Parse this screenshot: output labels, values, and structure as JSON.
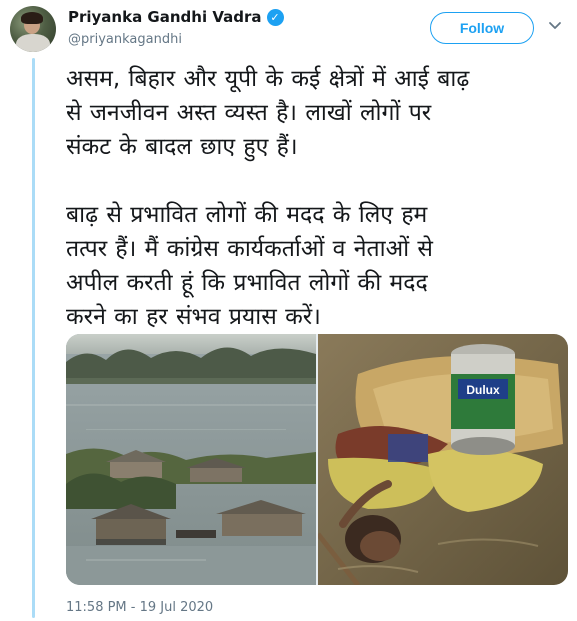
{
  "author": {
    "name": "Priyanka Gandhi Vadra",
    "handle": "@priyankagandhi",
    "verified_icon": "verified-badge-icon"
  },
  "follow_button": {
    "label": "Follow"
  },
  "menu_icon": "chevron-down-icon",
  "tweet": {
    "text": "असम, बिहार और यूपी के कई क्षेत्रों में आई बाढ़\nसे जनजीवन अस्त व्यस्त है। लाखों लोगों पर\nसंकट के बादल छाए हुए हैं।\n\nबाढ़ से प्रभावित लोगों की मदद के लिए हम\nतत्पर हैं। मैं कांग्रेस कार्यकर्ताओं व नेताओं से\nअपील करती हूं कि प्रभावित लोगों की मदद\nकरने का हर संभव प्रयास करें।",
    "timestamp": "11:58 PM - 19 Jul 2020"
  },
  "media": {
    "images": [
      {
        "name": "flooded-village-photo"
      },
      {
        "name": "man-swimming-with-belongings-photo",
        "can_label": "Dulux"
      }
    ]
  },
  "colors": {
    "accent": "#1da1f2",
    "thread_line": "#abdcf7",
    "secondary_text": "#657786"
  }
}
